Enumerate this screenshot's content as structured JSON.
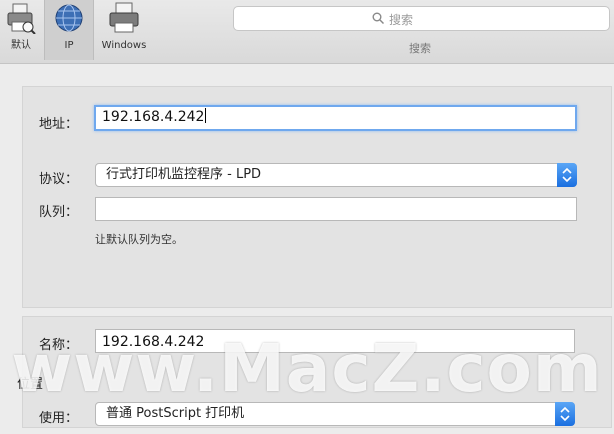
{
  "toolbar": {
    "items": [
      {
        "label": "默认",
        "icon": "default-printer-icon"
      },
      {
        "label": "IP",
        "icon": "globe-icon",
        "selected": true
      },
      {
        "label": "Windows",
        "icon": "windows-printer-icon"
      }
    ],
    "search": {
      "placeholder": "搜索",
      "caption": "搜索"
    }
  },
  "form": {
    "address": {
      "label": "地址：",
      "value": "192.168.4.242"
    },
    "protocol": {
      "label": "协议：",
      "value": "行式打印机监控程序 - LPD"
    },
    "queue": {
      "label": "队列：",
      "value": "",
      "hint": "让默认队列为空。"
    },
    "name": {
      "label": "名称：",
      "value": "192.168.4.242"
    },
    "location": {
      "label": "位置"
    },
    "use": {
      "label": "使用：",
      "value": "普通 PostScript 打印机"
    }
  },
  "watermark": "www.MacZ.com",
  "colors": {
    "accent": "#1a6fe0",
    "focus_ring": "#6fa8ee",
    "toolbar_bg": "#dedede"
  }
}
